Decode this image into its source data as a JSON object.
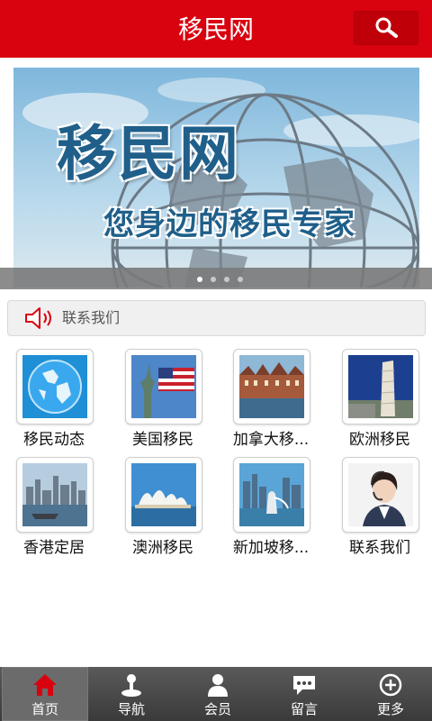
{
  "header": {
    "title": "移民网"
  },
  "banner": {
    "title": "移民网",
    "slogan": "您身边的移民专家",
    "slide_count": 4,
    "active_slide": 1
  },
  "notice": {
    "text": "联系我们",
    "icon": "speaker-icon"
  },
  "grid": {
    "items": [
      {
        "label": "移民动态",
        "icon": "globe-icon"
      },
      {
        "label": "美国移民",
        "icon": "usa-icon"
      },
      {
        "label": "加拿大移...",
        "icon": "canada-icon"
      },
      {
        "label": "欧洲移民",
        "icon": "europe-icon"
      },
      {
        "label": "香港定居",
        "icon": "hongkong-icon"
      },
      {
        "label": "澳洲移民",
        "icon": "australia-icon"
      },
      {
        "label": "新加坡移...",
        "icon": "singapore-icon"
      },
      {
        "label": "联系我们",
        "icon": "contact-icon"
      }
    ]
  },
  "tabbar": {
    "active": 0,
    "tabs": [
      {
        "label": "首页",
        "icon": "home-icon"
      },
      {
        "label": "导航",
        "icon": "joystick-icon"
      },
      {
        "label": "会员",
        "icon": "user-icon"
      },
      {
        "label": "留言",
        "icon": "chat-icon"
      },
      {
        "label": "更多",
        "icon": "plus-circle-icon"
      }
    ]
  },
  "colors": {
    "brand": "#d9020f",
    "tabbar": "#3e3e3e"
  }
}
